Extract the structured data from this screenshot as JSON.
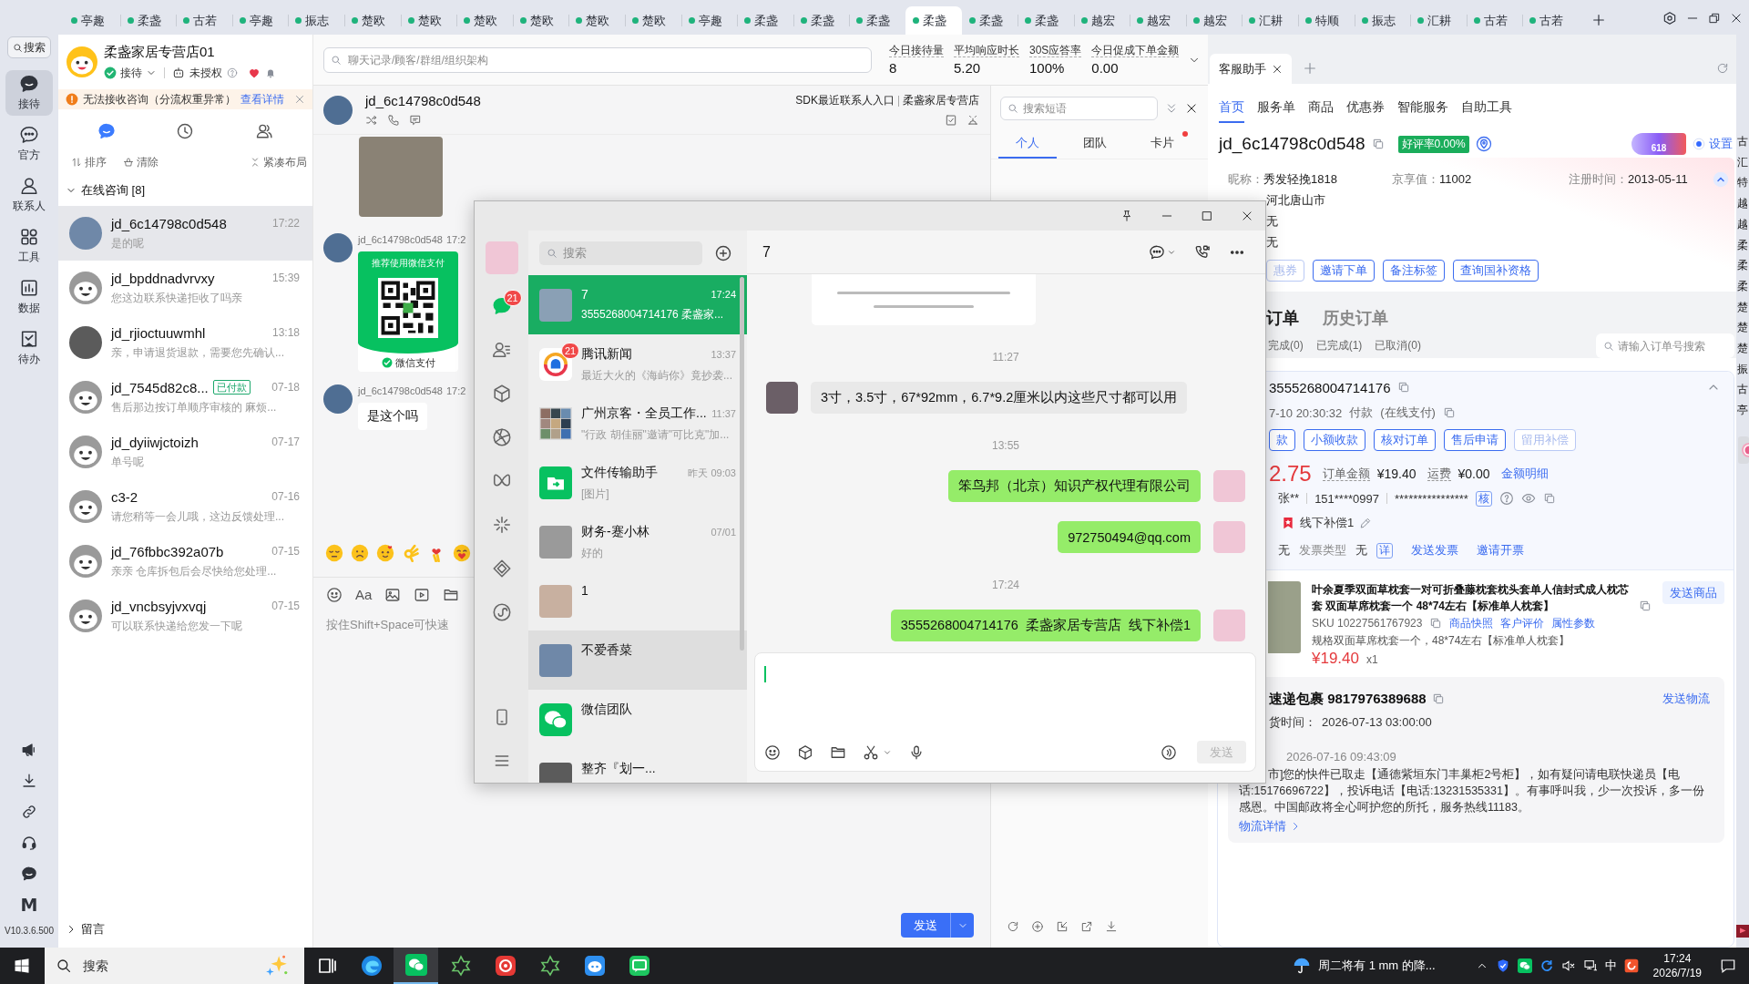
{
  "top_tabs": [
    {
      "label": "亭趣",
      "selected": false
    },
    {
      "label": "柔盏",
      "selected": false
    },
    {
      "label": "古若",
      "selected": false
    },
    {
      "label": "亭趣",
      "selected": false
    },
    {
      "label": "振志",
      "selected": false
    },
    {
      "label": "楚欧",
      "selected": false
    },
    {
      "label": "楚欧",
      "selected": false
    },
    {
      "label": "楚欧",
      "selected": false
    },
    {
      "label": "楚欧",
      "selected": false
    },
    {
      "label": "楚欧",
      "selected": false
    },
    {
      "label": "楚欧",
      "selected": false
    },
    {
      "label": "亭趣",
      "selected": false
    },
    {
      "label": "柔盏",
      "selected": false
    },
    {
      "label": "柔盏",
      "selected": false
    },
    {
      "label": "柔盏",
      "selected": false
    },
    {
      "label": "柔盏",
      "selected": true
    },
    {
      "label": "柔盏",
      "selected": false
    },
    {
      "label": "柔盏",
      "selected": false
    },
    {
      "label": "越宏",
      "selected": false
    },
    {
      "label": "越宏",
      "selected": false
    },
    {
      "label": "越宏",
      "selected": false
    },
    {
      "label": "汇耕",
      "selected": false
    },
    {
      "label": "特顺",
      "selected": false
    },
    {
      "label": "振志",
      "selected": false
    },
    {
      "label": "汇耕",
      "selected": false
    },
    {
      "label": "古若",
      "selected": false
    },
    {
      "label": "古若",
      "selected": false
    }
  ],
  "rail": {
    "search": "搜索",
    "items": [
      {
        "kind": "reception",
        "label": "接待",
        "selected": true
      },
      {
        "kind": "official",
        "label": "官方",
        "selected": false
      },
      {
        "kind": "contacts",
        "label": "联系人",
        "selected": false
      },
      {
        "kind": "tools",
        "label": "工具",
        "selected": false
      },
      {
        "kind": "data",
        "label": "数据",
        "selected": false
      },
      {
        "kind": "todo",
        "label": "待办",
        "selected": false
      }
    ],
    "logo": "M",
    "version": "V10.3.6.500"
  },
  "shop": {
    "name": "柔盏家居专营店01",
    "status": "接待",
    "auth": "未授权"
  },
  "alert": {
    "text": "无法接收咨询（分流权重异常）",
    "link": "查看详情"
  },
  "list_tabs": [
    {
      "kind": "chat",
      "selected": true
    },
    {
      "kind": "history",
      "selected": false
    },
    {
      "kind": "team",
      "selected": false
    }
  ],
  "list_tools": [
    {
      "kind": "sort",
      "label": "排序"
    },
    {
      "kind": "clear",
      "label": "清除"
    },
    {
      "kind": "compact",
      "label": "紧凑布局"
    }
  ],
  "online_group": {
    "title": "在线咨询 [8]",
    "expanded": true
  },
  "conversations": [
    {
      "name": "jd_6c14798c0d548",
      "time": "17:22",
      "preview": "是的呢",
      "avatar": {
        "kind": "photo"
      },
      "selected": true
    },
    {
      "name": "jd_bpddnadvrvxy",
      "time": "15:39",
      "preview": "您这边联系快递拒收了吗亲",
      "avatar": {
        "kind": "mascot"
      },
      "selected": false
    },
    {
      "name": "jd_rjioctuuwmhl",
      "time": "13:18",
      "preview": "亲，申请退货退款，需要您先确认...",
      "avatar": {
        "kind": "photo"
      },
      "selected": false
    },
    {
      "name": "jd_7545d82c8...",
      "tag": "已付款",
      "time": "07-18",
      "preview": "售后那边按订单顺序审核的 麻烦...",
      "avatar": {
        "kind": "mascot"
      },
      "selected": false
    },
    {
      "name": "jd_dyiiwjctoizh",
      "time": "07-17",
      "preview": "单号呢",
      "avatar": {
        "kind": "mascot"
      },
      "selected": false
    },
    {
      "name": "c3-2",
      "time": "07-16",
      "preview": "请您稍等一会儿哦，这边反馈处理...",
      "avatar": {
        "kind": "mascot"
      },
      "selected": false
    },
    {
      "name": "jd_76fbbc392a07b",
      "time": "07-15",
      "preview": "亲亲 仓库拆包后会尽快给您处理...",
      "avatar": {
        "kind": "mascot"
      },
      "selected": false
    },
    {
      "name": "jd_vncbsyjvxvqj",
      "time": "07-15",
      "preview": "可以联系快递给您发一下呢",
      "avatar": {
        "kind": "mascot"
      },
      "selected": false
    }
  ],
  "leave_group": {
    "title": "留言",
    "expanded": false
  },
  "search": {
    "placeholder": "聊天记录/顾客/群组/组织架构"
  },
  "stats": [
    {
      "label": "今日接待量",
      "value": "8"
    },
    {
      "label": "平均响应时长",
      "value": "5.20"
    },
    {
      "label": "30S应答率",
      "value": "100%"
    },
    {
      "label": "今日促成下单金额",
      "value": "0.00"
    }
  ],
  "chat": {
    "name": "jd_6c14798c0d548",
    "links": [
      "SDK最近联系人入口",
      "柔盏家居专营店"
    ],
    "messages": [
      {
        "kind": "image"
      },
      {
        "kind": "pay_card",
        "sender": "jd_6c14798c0d548",
        "time": "17:2",
        "title": "推荐使用微信支付",
        "caption": "微信支付"
      },
      {
        "kind": "text",
        "sender": "jd_6c14798c0d548",
        "time": "17:2",
        "text": "是这个吗"
      }
    ],
    "font_tool": "Aa",
    "input": {
      "placeholder": "按住Shift+Space可快速"
    },
    "send": "发送"
  },
  "phrases": {
    "search": {
      "placeholder": "搜索短语"
    },
    "tabs": [
      {
        "label": "个人",
        "selected": true,
        "dot": false
      },
      {
        "label": "团队",
        "selected": false,
        "dot": false
      },
      {
        "label": "卡片",
        "selected": false,
        "dot": true
      }
    ]
  },
  "assistant": {
    "tab": "客服助手",
    "nav": [
      {
        "label": "首页",
        "selected": true
      },
      {
        "label": "服务单",
        "selected": false
      },
      {
        "label": "商品",
        "selected": false
      },
      {
        "label": "优惠券",
        "selected": false
      },
      {
        "label": "智能服务",
        "selected": false
      },
      {
        "label": "自助工具",
        "selected": false
      }
    ],
    "customer": "jd_6c14798c0d548",
    "rating": "好评率0.00%",
    "promo": "618",
    "settings": "设置",
    "profile": [
      {
        "label": "昵称：",
        "value": "秀发轻挽1818"
      },
      {
        "label": "京享值：",
        "value": "11002"
      },
      {
        "label": "注册时间：",
        "value": "2013-05-11"
      }
    ],
    "region": "河北唐山市",
    "extra": [
      "无",
      "无"
    ],
    "actions": [
      {
        "label": "惠券",
        "disabled": true
      },
      {
        "label": "邀请下单",
        "disabled": false
      },
      {
        "label": "备注标签",
        "disabled": false
      },
      {
        "label": "查询国补资格",
        "disabled": false
      }
    ],
    "order_tabs": [
      {
        "label": "订单",
        "selected": true
      },
      {
        "label": "历史订单",
        "selected": false
      }
    ],
    "order_filters": [
      "完成(0)",
      "已完成(1)",
      "已取消(0)"
    ],
    "order_search": {
      "placeholder": "请输入订单号搜索"
    },
    "order": {
      "id": "3555268004714176",
      "expanded": true,
      "paid_time": "7-10 20:30:32",
      "pay_label": "付款",
      "pay_method": "(在线支付)",
      "actions": [
        {
          "label": "款",
          "disabled": false
        },
        {
          "label": "小额收款",
          "disabled": false
        },
        {
          "label": "核对订单",
          "disabled": false
        },
        {
          "label": "售后申请",
          "disabled": false
        },
        {
          "label": "留用补偿",
          "disabled": true
        }
      ],
      "paid_amount": "2.75",
      "amount_label": "订单金额",
      "amount": "¥19.40",
      "freight_label": "运费",
      "freight": "¥0.00",
      "detail_link": "金额明细",
      "receiver": "张**",
      "phone": "151****0997",
      "address": "****************",
      "verify": "核",
      "remark": "线下补偿1",
      "invoice": {
        "value": "无",
        "type_label": "发票类型",
        "type": "无",
        "detail": "详",
        "send": "发送发票",
        "invite": "邀请开票"
      },
      "product": {
        "title": "叶余夏季双面草枕套一对可折叠藤枕套枕头套单人信封式成人枕芯套 双面草席枕套一个 48*74左右【标准单人枕套】",
        "send": "发送商品",
        "sku": "SKU 10227561767923",
        "links": [
          "商品快照",
          "客户评价",
          "属性参数"
        ],
        "spec": "规格双面草席枕套一个，48*74左右【标准单人枕套】",
        "price": "¥19.40",
        "qty": "x1"
      },
      "logistics": {
        "title": "速递包裹 9817976389688",
        "send": "发送物流",
        "ship_label": "货时间：",
        "ship_time": "2026-07-13 03:00:00",
        "event_time": "2026-07-16 09:43:09",
        "event": "市]您的快件已取走【通德紫垣东门丰巢柜2号柜】，如有疑问请电联快递员【电话:15176696722】，投诉电话【电话:13231535331】。有事呼叫我，少一次投诉，多一份感恩。中国邮政将全心呵护您的所托，服务热线11183。",
        "detail": "物流详情"
      }
    }
  },
  "side_list": [
    "古",
    "汇",
    "特",
    "越",
    "越",
    "柔",
    "柔",
    "柔",
    "楚",
    "楚",
    "楚",
    "振",
    "古",
    "亭"
  ],
  "wechat": {
    "nav": [
      {
        "kind": "chats",
        "selected": true,
        "badge": "21"
      },
      {
        "kind": "contacts",
        "selected": false
      },
      {
        "kind": "favorites",
        "selected": false
      },
      {
        "kind": "moments",
        "selected": false
      },
      {
        "kind": "channels",
        "selected": false
      },
      {
        "kind": "discover",
        "selected": false
      },
      {
        "kind": "miniapps",
        "selected": false
      },
      {
        "kind": "apps",
        "selected": false
      }
    ],
    "search": {
      "placeholder": "搜索"
    },
    "chats": [
      {
        "name": "7",
        "time": "17:24",
        "preview": "3555268004714176 柔盏家...",
        "avatar": {
          "kind": "photo"
        },
        "selected": true,
        "hovered": false
      },
      {
        "name": "腾讯新闻",
        "time": "13:37",
        "preview": "最近大火的《海屿你》竟抄袭...",
        "avatar": {
          "kind": "news"
        },
        "badge": "21",
        "selected": false,
        "hovered": false
      },
      {
        "name": "广州京客・全员工作...",
        "time": "11:37",
        "preview": "\"行政 胡佳丽\"邀请\"可比克\"加...",
        "avatar": {
          "kind": "group"
        },
        "selected": false,
        "hovered": false
      },
      {
        "name": "文件传输助手",
        "time": "昨天 09:03",
        "preview": "[图片]",
        "avatar": {
          "kind": "file"
        },
        "selected": false,
        "hovered": false
      },
      {
        "name": "财务-蹇小林",
        "time": "07/01",
        "preview": "好的",
        "avatar": {
          "kind": "photo"
        },
        "selected": false,
        "hovered": false
      },
      {
        "name": "1",
        "avatar": {
          "kind": "photo"
        },
        "selected": false,
        "hovered": false
      },
      {
        "name": "不爱香菜",
        "avatar": {
          "kind": "photo"
        },
        "selected": false,
        "hovered": true
      },
      {
        "name": "微信团队",
        "avatar": {
          "kind": "wechat"
        },
        "selected": false,
        "hovered": false
      },
      {
        "name": "整齐『划一...",
        "avatar": {
          "kind": "photo"
        },
        "selected": false,
        "hovered": false
      }
    ],
    "title": "7",
    "messages": [
      {
        "kind": "image"
      },
      {
        "kind": "time",
        "text": "11:27"
      },
      {
        "kind": "in",
        "text": "3寸，3.5寸，67*92mm，6.7*9.2厘米以内这些尺寸都可以用"
      },
      {
        "kind": "time",
        "text": "13:55"
      },
      {
        "kind": "out",
        "text": "笨鸟邦（北京）知识产权代理有限公司"
      },
      {
        "kind": "out",
        "text": "972750494@qq.com"
      },
      {
        "kind": "time",
        "text": "17:24"
      },
      {
        "kind": "out",
        "text": "3555268004714176  柔盏家居专营店  线下补偿1"
      }
    ],
    "send": "发送"
  },
  "taskbar": {
    "search": {
      "placeholder": "搜索"
    },
    "apps": [
      {
        "kind": "taskview",
        "selected": false
      },
      {
        "kind": "browser",
        "selected": false
      },
      {
        "kind": "wechat",
        "selected": true
      },
      {
        "kind": "hexagram",
        "selected": false
      },
      {
        "kind": "ring",
        "selected": false
      },
      {
        "kind": "hexagram",
        "selected": false
      },
      {
        "kind": "robot",
        "selected": false
      },
      {
        "kind": "chat",
        "selected": false
      }
    ],
    "weather": "周二将有 1 mm 的降...",
    "ime": "中",
    "time": "17:24",
    "date": "2026/7/19"
  }
}
